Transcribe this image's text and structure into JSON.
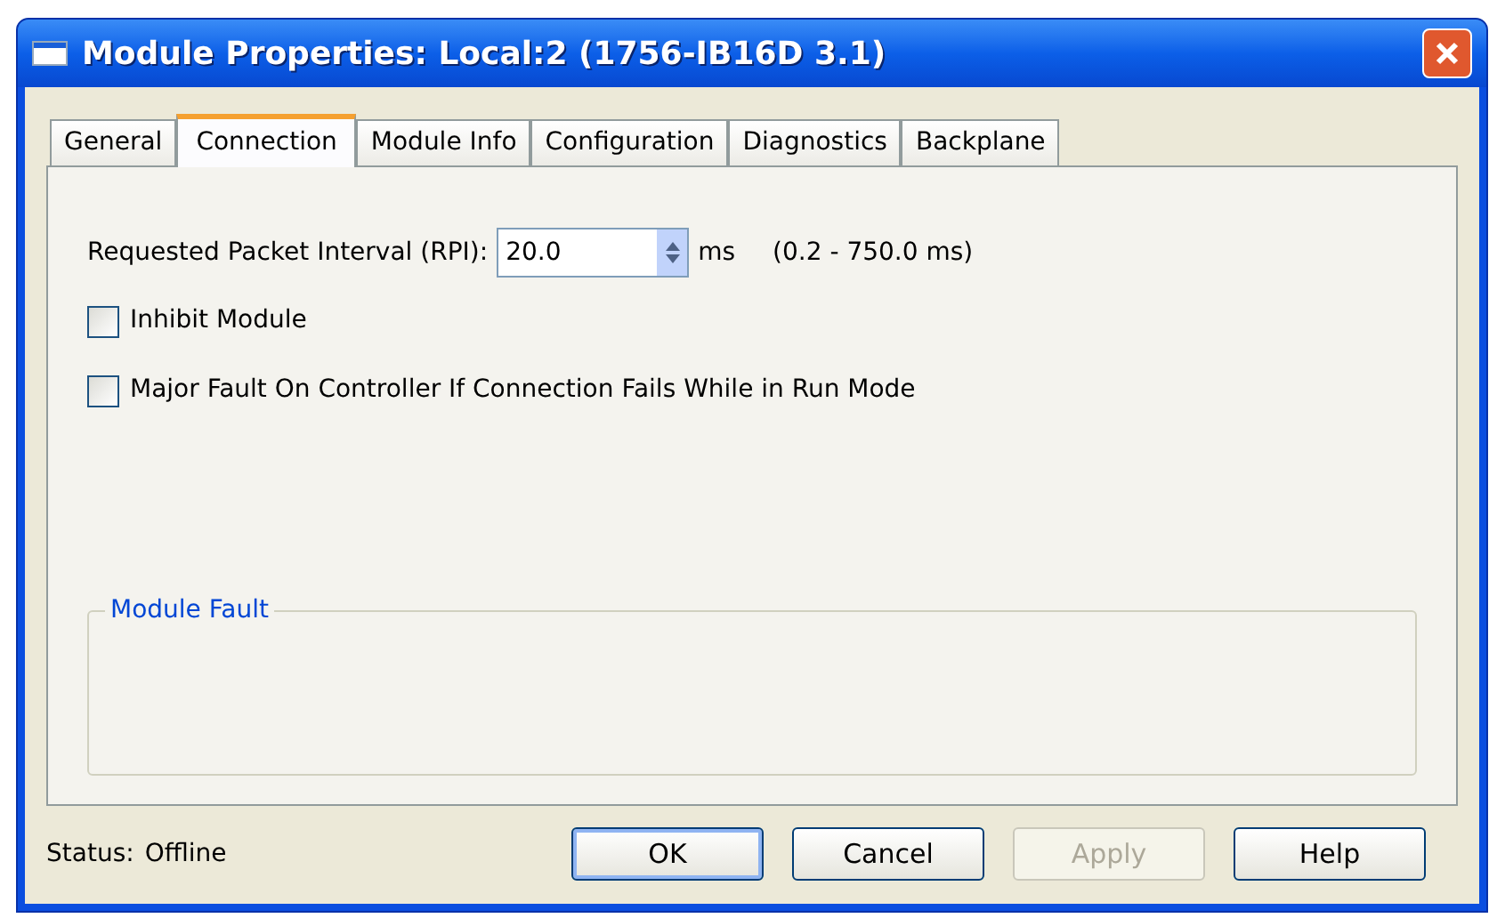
{
  "window": {
    "title": "Module Properties: Local:2 (1756-IB16D 3.1)"
  },
  "tabs": [
    {
      "label": "General",
      "selected": false
    },
    {
      "label": "Connection",
      "selected": true
    },
    {
      "label": "Module Info",
      "selected": false
    },
    {
      "label": "Configuration",
      "selected": false
    },
    {
      "label": "Diagnostics",
      "selected": false
    },
    {
      "label": "Backplane",
      "selected": false
    }
  ],
  "rpi": {
    "label": "Requested Packet Interval (RPI):",
    "value": "20.0",
    "unit": "ms",
    "range": "(0.2 - 750.0 ms)"
  },
  "checkboxes": [
    {
      "label": "Inhibit Module",
      "checked": false
    },
    {
      "label": "Major Fault On Controller If Connection Fails While in Run Mode",
      "checked": false
    }
  ],
  "module_fault": {
    "title": "Module Fault"
  },
  "status": {
    "label": "Status:",
    "value": "Offline"
  },
  "buttons": [
    {
      "label": "OK",
      "disabled": false,
      "default": true
    },
    {
      "label": "Cancel",
      "disabled": false,
      "default": false
    },
    {
      "label": "Apply",
      "disabled": true,
      "default": false
    },
    {
      "label": "Help",
      "disabled": false,
      "default": false
    }
  ]
}
